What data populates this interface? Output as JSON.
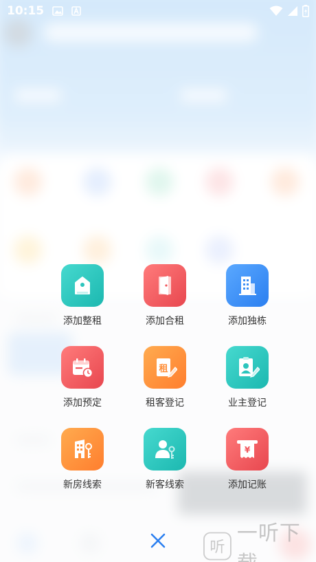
{
  "status_bar": {
    "time": "10:15"
  },
  "actions": [
    {
      "label": "添加整租",
      "icon": "house-icon",
      "color": "#2cc5bd"
    },
    {
      "label": "添加合租",
      "icon": "door-icon",
      "color": "#f2565c"
    },
    {
      "label": "添加独栋",
      "icon": "building-icon",
      "color": "#3b8ef5"
    },
    {
      "label": "添加预定",
      "icon": "calendar-clock-icon",
      "color": "#f2565c"
    },
    {
      "label": "租客登记",
      "icon": "rent-edit-icon",
      "color": "#ff8d36"
    },
    {
      "label": "业主登记",
      "icon": "id-card-edit-icon",
      "color": "#2cc5bd"
    },
    {
      "label": "新房线索",
      "icon": "building-key-icon",
      "color": "#ff8d36"
    },
    {
      "label": "新客线索",
      "icon": "person-key-icon",
      "color": "#2cc5bd"
    },
    {
      "label": "添加记账",
      "icon": "yen-receipt-icon",
      "color": "#f2565c"
    }
  ],
  "icon_glyphs": {
    "rent": "租",
    "yen": "¥"
  },
  "close": {
    "icon": "close-icon",
    "color": "#2b7ff0"
  },
  "watermark": {
    "text": "一听下载",
    "logo": "听"
  }
}
